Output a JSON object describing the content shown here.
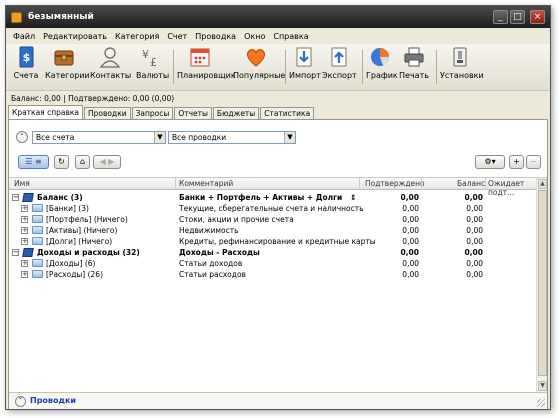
{
  "window": {
    "title": "безымянный"
  },
  "menu": [
    "Файл",
    "Редактировать",
    "Категория",
    "Счет",
    "Проводка",
    "Окно",
    "Справка"
  ],
  "toolbar": {
    "accounts": "Счета",
    "categories": "Категории",
    "contacts": "Контакты",
    "currencies": "Валюты",
    "scheduler": "Планировщик",
    "popular": "Популярные",
    "import": "Импорт",
    "export": "Экспорт",
    "chart": "График",
    "print": "Печать",
    "settings": "Установки"
  },
  "status": "Баланс: 0,00 | Подтверждено: 0,00 (0,00)",
  "tabs": [
    "Краткая справка",
    "Проводки",
    "Запросы",
    "Отчеты",
    "Бюджеты",
    "Статистика"
  ],
  "filters": {
    "accounts": "Все счета",
    "transactions": "Все проводки"
  },
  "grid": {
    "headers": {
      "name": "Имя",
      "comment": "Комментарий",
      "confirmed": "Подтверждено",
      "balance": "Баланс",
      "pending": "Ожидает подт..."
    },
    "rows": [
      {
        "level": 0,
        "icon": "book",
        "name": "Баланс (3)",
        "comment": "Банки + Портфель + Активы + Долги",
        "confirmed": "0,00",
        "balance": "0,00",
        "bold": true,
        "sort": true
      },
      {
        "level": 1,
        "icon": "folder",
        "name": "[Банки] (3)",
        "comment": "Текущие, сберегательные счета и наличность",
        "confirmed": "0,00",
        "balance": "0,00"
      },
      {
        "level": 1,
        "icon": "folder",
        "name": "[Портфель] (Ничего)",
        "comment": "Стоки, акции и прочие счета",
        "confirmed": "0,00",
        "balance": "0,00"
      },
      {
        "level": 1,
        "icon": "folder",
        "name": "[Активы] (Ничего)",
        "comment": "Недвижимость",
        "confirmed": "0,00",
        "balance": "0,00"
      },
      {
        "level": 1,
        "icon": "folder",
        "name": "[Долги] (Ничего)",
        "comment": "Кредиты, рефинансирование и кредитные карты",
        "confirmed": "0,00",
        "balance": "0,00"
      },
      {
        "level": 0,
        "icon": "book",
        "name": "Доходы и расходы (32)",
        "comment": "Доходы - Расходы",
        "confirmed": "0,00",
        "balance": "0,00",
        "bold": true
      },
      {
        "level": 1,
        "icon": "folder",
        "name": "[Доходы] (6)",
        "comment": "Статьи доходов",
        "confirmed": "0,00",
        "balance": "0,00"
      },
      {
        "level": 1,
        "icon": "folder",
        "name": "[Расходы] (26)",
        "comment": "Статьи расходов",
        "confirmed": "0,00",
        "balance": "0,00"
      }
    ]
  },
  "footer": {
    "label": "Проводки"
  }
}
